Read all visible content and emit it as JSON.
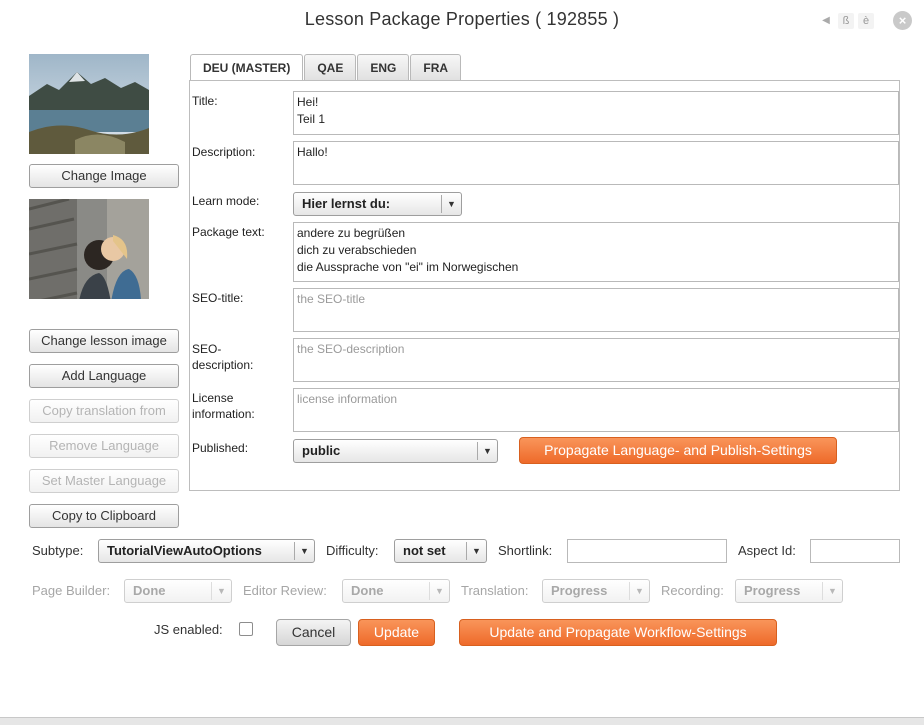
{
  "dialog": {
    "title": "Lesson Package Properties ( 192855 )",
    "icons": {
      "back": "◀",
      "beta": "ß",
      "accent": "è",
      "close": "×"
    }
  },
  "left": {
    "change_image": "Change Image",
    "change_lesson_image": "Change lesson image",
    "add_language": "Add Language",
    "copy_translation": "Copy translation from",
    "remove_language": "Remove Language",
    "set_master": "Set Master Language",
    "copy_clipboard": "Copy to Clipboard"
  },
  "tabs": [
    "DEU (MASTER)",
    "QAE",
    "ENG",
    "FRA"
  ],
  "form": {
    "title_label": "Title:",
    "title_value": "Hei!\nTeil 1",
    "description_label": "Description:",
    "description_value": "Hallo!",
    "learn_mode_label": "Learn mode:",
    "learn_mode_value": "Hier lernst du:",
    "package_text_label": "Package text:",
    "package_text_value": "andere zu begrüßen\ndich zu verabschieden\ndie Aussprache von \"ei\" im Norwegischen",
    "seo_title_label": "SEO-title:",
    "seo_title_placeholder": "the SEO-title",
    "seo_description_label": "SEO-\ndescription:",
    "seo_description_placeholder": "the SEO-description",
    "license_label": "License\ninformation:",
    "license_placeholder": "license information",
    "published_label": "Published:",
    "published_value": "public",
    "propagate_language": "Propagate Language- and Publish-Settings"
  },
  "bottom": {
    "subtype_label": "Subtype:",
    "subtype_value": "TutorialViewAutoOptions",
    "difficulty_label": "Difficulty:",
    "difficulty_value": "not set",
    "shortlink_label": "Shortlink:",
    "shortlink_value": "",
    "aspect_label": "Aspect Id:",
    "aspect_value": "",
    "page_builder_label": "Page Builder:",
    "page_builder_value": "Done",
    "editor_review_label": "Editor Review:",
    "editor_review_value": "Done",
    "translation_label": "Translation:",
    "translation_value": "Progress",
    "recording_label": "Recording:",
    "recording_value": "Progress",
    "js_enabled_label": "JS enabled:",
    "cancel": "Cancel",
    "update": "Update",
    "update_propagate": "Update and Propagate Workflow-Settings",
    "dropdown_arrow": "▼"
  },
  "colors": {
    "accent": "#ef6f2f",
    "panel_border": "#bdbdbd"
  }
}
